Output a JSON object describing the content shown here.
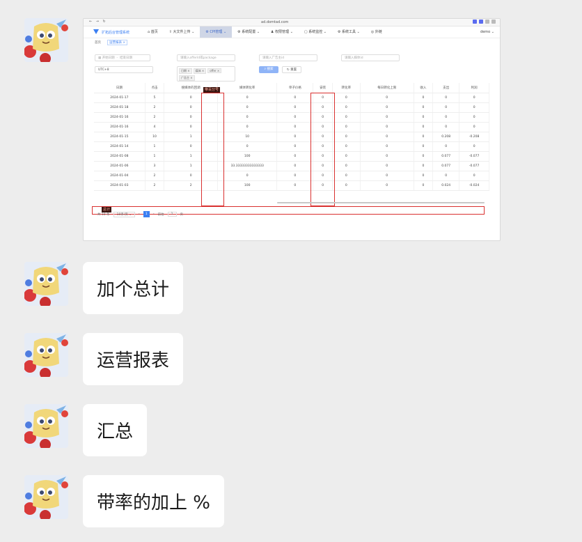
{
  "screenshot": {
    "browser": {
      "url": "ad.domtad.com",
      "nav": "← → ↻"
    },
    "app": {
      "system_name": "扩拓后台管理系统",
      "menu": [
        {
          "label": "⌂ 首页",
          "active": false
        },
        {
          "label": "⇪ 大文件上传 ⌄",
          "active": false
        },
        {
          "label": "⚙ CPI管理 ⌄",
          "active": true
        },
        {
          "label": "⚙ 系统配置 ⌄",
          "active": false
        },
        {
          "label": "♟ 权限管理 ⌄",
          "active": false
        },
        {
          "label": "▢ 系统监控 ⌄",
          "active": false
        },
        {
          "label": "⚙ 系统工具 ⌄",
          "active": false
        },
        {
          "label": "◎ 外链",
          "active": false
        }
      ],
      "user": "demo ⌄",
      "tabs": [
        "首页",
        "运营报表 ×"
      ]
    },
    "filters": {
      "start_date": "开始日期",
      "end_date": "结束日期",
      "package_placeholder": "请输入offerId或package",
      "ad_id_placeholder": "请输入广告主id",
      "channel_placeholder": "请输入媒体id",
      "timezone": "UTC+8",
      "tags": [
        "日期 ×",
        "媒体 ×",
        "offer ×",
        "广告主 ×"
      ],
      "search_button": "搜索",
      "reset_button": "重置"
    },
    "table": {
      "headers": [
        "日期",
        "点击",
        "搜媒体的回调",
        "媒体转化率",
        "单子价格",
        "安装",
        "转化率",
        "每日转化上限",
        "收入",
        "支出",
        "利润"
      ],
      "rows": [
        [
          "2024-01-17",
          "5",
          "0",
          "0",
          "0",
          "0",
          "0",
          "0",
          "0",
          "0",
          "0"
        ],
        [
          "2024-01-18",
          "2",
          "0",
          "0",
          "0",
          "0",
          "0",
          "0",
          "0",
          "0",
          "0"
        ],
        [
          "2024-01-16",
          "2",
          "0",
          "0",
          "0",
          "0",
          "0",
          "0",
          "0",
          "0",
          "0"
        ],
        [
          "2024-01-16",
          "4",
          "0",
          "0",
          "0",
          "0",
          "0",
          "0",
          "0",
          "0",
          "0"
        ],
        [
          "2024-01-15",
          "10",
          "1",
          "10",
          "0",
          "0",
          "0",
          "0",
          "0",
          "0.208",
          "-0.208"
        ],
        [
          "2024-01-14",
          "1",
          "0",
          "0",
          "0",
          "0",
          "0",
          "0",
          "0",
          "0",
          "0"
        ],
        [
          "2024-01-08",
          "1",
          "1",
          "100",
          "0",
          "0",
          "0",
          "0",
          "0",
          "0.077",
          "-0.077"
        ],
        [
          "2024-01-06",
          "3",
          "1",
          "33.33333333333333",
          "0",
          "0",
          "0",
          "0",
          "0",
          "0.077",
          "-0.077"
        ],
        [
          "2024-01-04",
          "2",
          "0",
          "0",
          "0",
          "0",
          "0",
          "0",
          "0",
          "0",
          "0"
        ],
        [
          "2024-01-03",
          "2",
          "2",
          "100",
          "0",
          "0",
          "0",
          "0",
          "0",
          "0.024",
          "-0.024"
        ]
      ],
      "annotation_label": "带百分号",
      "total_label": "总计"
    },
    "pagination": {
      "total": "共 10 条",
      "page_size": "10条/页 ⌄",
      "current": "1",
      "goto_label": "前往",
      "goto_value": "1",
      "page_suffix": "页"
    }
  },
  "messages": [
    "加个总计",
    "运营报表",
    "汇总",
    "带率的加上 %"
  ]
}
